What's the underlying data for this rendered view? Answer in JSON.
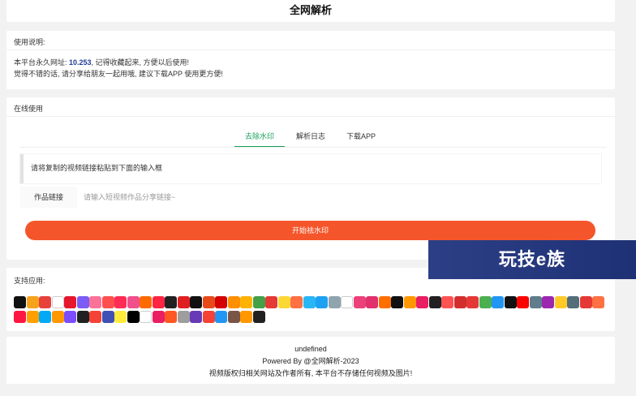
{
  "header": {
    "title": "全网解析"
  },
  "usage": {
    "title": "使用说明:",
    "line1_prefix": "本平台永久网址: ",
    "line1_domain": "10.253",
    "line1_suffix": ", 记得收藏起来, 方便以后使用!",
    "line2": "觉得不错的话, 请分享给朋友一起用哦, 建议下载APP 使用更方便!"
  },
  "online": {
    "title": "在线使用",
    "tabs": [
      {
        "label": "去除水印",
        "active": true
      },
      {
        "label": "解析日志",
        "active": false
      },
      {
        "label": "下载APP",
        "active": false
      }
    ],
    "tip": "请将复制的视频链接粘贴到下面的输入框",
    "field_label": "作品链接",
    "field_placeholder": "请输入短视频作品分享链接~",
    "field_value": "",
    "start_label": "开始祛水印"
  },
  "banner": {
    "text": "玩技e族"
  },
  "apps": {
    "title": "支持应用:",
    "icons": [
      {
        "name": "douyin-icon",
        "color": "#111111"
      },
      {
        "name": "app-icon",
        "color": "#f7a21b"
      },
      {
        "name": "app-icon",
        "color": "#e8413c"
      },
      {
        "name": "app-icon",
        "color": "#ffffff"
      },
      {
        "name": "weibo-icon",
        "color": "#e6162d"
      },
      {
        "name": "app-icon",
        "color": "#7b5cf5"
      },
      {
        "name": "app-icon",
        "color": "#fb7299"
      },
      {
        "name": "app-icon",
        "color": "#ff4f4f"
      },
      {
        "name": "app-icon",
        "color": "#ff2d55"
      },
      {
        "name": "app-icon",
        "color": "#f04e8c"
      },
      {
        "name": "app-icon",
        "color": "#ff6a00"
      },
      {
        "name": "app-icon",
        "color": "#ff2442"
      },
      {
        "name": "app-icon",
        "color": "#222222"
      },
      {
        "name": "app-icon",
        "color": "#e02020"
      },
      {
        "name": "app-icon",
        "color": "#111111"
      },
      {
        "name": "app-icon",
        "color": "#e64a19"
      },
      {
        "name": "app-icon",
        "color": "#d50000"
      },
      {
        "name": "app-icon",
        "color": "#ff8f00"
      },
      {
        "name": "app-icon",
        "color": "#ffb300"
      },
      {
        "name": "app-icon",
        "color": "#43a047"
      },
      {
        "name": "app-icon",
        "color": "#e53935"
      },
      {
        "name": "app-icon",
        "color": "#fdd835"
      },
      {
        "name": "app-icon",
        "color": "#ff7043"
      },
      {
        "name": "app-icon",
        "color": "#29b6f6"
      },
      {
        "name": "app-icon",
        "color": "#1da1f2"
      },
      {
        "name": "app-icon",
        "color": "#90a4ae"
      },
      {
        "name": "app-icon",
        "color": "#ffffff"
      },
      {
        "name": "app-icon",
        "color": "#ec407a"
      },
      {
        "name": "instagram-icon",
        "color": "#e1306c"
      },
      {
        "name": "app-icon",
        "color": "#ff6f00"
      },
      {
        "name": "app-icon",
        "color": "#111111"
      },
      {
        "name": "app-icon",
        "color": "#ff9800"
      },
      {
        "name": "app-icon",
        "color": "#e91e63"
      },
      {
        "name": "app-icon",
        "color": "#212121"
      },
      {
        "name": "app-icon",
        "color": "#ff5252"
      },
      {
        "name": "app-icon",
        "color": "#d32f2f"
      },
      {
        "name": "app-icon",
        "color": "#e53935"
      },
      {
        "name": "app-icon",
        "color": "#4caf50"
      },
      {
        "name": "app-icon",
        "color": "#2196f3"
      },
      {
        "name": "app-icon",
        "color": "#111111"
      },
      {
        "name": "youtube-icon",
        "color": "#ff0000"
      },
      {
        "name": "app-icon",
        "color": "#607d8b"
      },
      {
        "name": "app-icon",
        "color": "#9c27b0"
      },
      {
        "name": "app-icon",
        "color": "#ffca28"
      },
      {
        "name": "app-icon",
        "color": "#546e7a"
      },
      {
        "name": "app-icon",
        "color": "#e53935"
      },
      {
        "name": "app-icon",
        "color": "#ff7043"
      },
      {
        "name": "app-icon",
        "color": "#ff1744"
      },
      {
        "name": "app-icon",
        "color": "#ffa000"
      },
      {
        "name": "app-icon",
        "color": "#03a9f4"
      },
      {
        "name": "app-icon",
        "color": "#ff9800"
      },
      {
        "name": "app-icon",
        "color": "#7c4dff"
      },
      {
        "name": "app-icon",
        "color": "#212121"
      },
      {
        "name": "app-icon",
        "color": "#f44336"
      },
      {
        "name": "app-icon",
        "color": "#3f51b5"
      },
      {
        "name": "app-icon",
        "color": "#ffeb3b"
      },
      {
        "name": "app-icon",
        "color": "#000000"
      },
      {
        "name": "app-icon",
        "color": "#ffffff"
      },
      {
        "name": "app-icon",
        "color": "#e91e63"
      },
      {
        "name": "app-icon",
        "color": "#ff5722"
      },
      {
        "name": "app-icon",
        "color": "#9e9e9e"
      },
      {
        "name": "app-icon",
        "color": "#673ab7"
      },
      {
        "name": "app-icon",
        "color": "#f44336"
      },
      {
        "name": "app-icon",
        "color": "#2196f3"
      },
      {
        "name": "app-icon",
        "color": "#795548"
      },
      {
        "name": "app-icon",
        "color": "#ff9800"
      },
      {
        "name": "app-icon",
        "color": "#212121"
      }
    ]
  },
  "footer": {
    "line1": "undefined",
    "line2": "Powered By @全网解析-2023",
    "line3": "视频版权归相关网站及作者所有, 本平台不存储任何视频及图片!"
  }
}
